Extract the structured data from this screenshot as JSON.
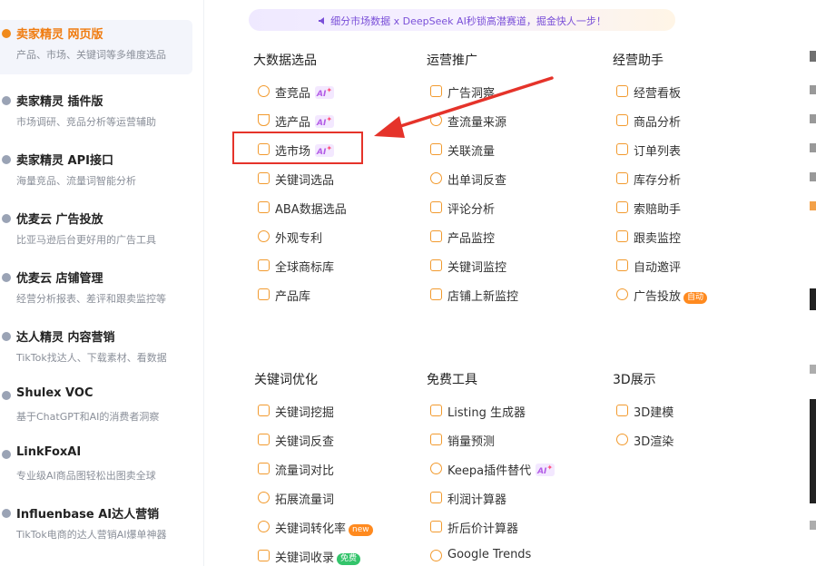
{
  "banner": {
    "text": "细分市场数据 x DeepSeek AI秒锁高潜赛道，掘金快人一步！"
  },
  "sidebar": {
    "items": [
      {
        "title": "卖家精灵 网页版",
        "subtitle": "产品、市场、关键词等多维度选品",
        "active": true
      },
      {
        "title": "卖家精灵 插件版",
        "subtitle": "市场调研、竞品分析等运营辅助",
        "active": false
      },
      {
        "title": "卖家精灵 API接口",
        "subtitle": "海量竞品、流量词智能分析",
        "active": false
      },
      {
        "title": "优麦云 广告投放",
        "subtitle": "比亚马逊后台更好用的广告工具",
        "active": false
      },
      {
        "title": "优麦云 店铺管理",
        "subtitle": "经营分析报表、差评和跟卖监控等",
        "active": false
      },
      {
        "title": "达人精灵 内容营销",
        "subtitle": "TikTok找达人、下载素材、看数据",
        "active": false
      },
      {
        "title": "Shulex VOC",
        "subtitle": "基于ChatGPT和AI的消费者洞察",
        "active": false
      },
      {
        "title": "LinkFoxAI",
        "subtitle": "专业级AI商品图轻松出图卖全球",
        "active": false
      },
      {
        "title": "Influenbase AI达人营销",
        "subtitle": "TikTok电商的达人营销AI爆单神器",
        "active": false
      }
    ]
  },
  "groups": {
    "bigdata": {
      "title": "大数据选品",
      "items": [
        "查竞品",
        "选产品",
        "选市场",
        "关键词选品",
        "ABA数据选品",
        "外观专利",
        "全球商标库",
        "产品库"
      ]
    },
    "ops": {
      "title": "运营推广",
      "items": [
        "广告洞察",
        "查流量来源",
        "关联流量",
        "出单词反查",
        "评论分析",
        "产品监控",
        "关键词监控",
        "店铺上新监控"
      ]
    },
    "assistant": {
      "title": "经营助手",
      "items": [
        "经营看板",
        "商品分析",
        "订单列表",
        "库存分析",
        "索赔助手",
        "跟卖监控",
        "自动邀评",
        "广告投放"
      ]
    },
    "keyword": {
      "title": "关键词优化",
      "items": [
        "关键词挖掘",
        "关键词反查",
        "流量词对比",
        "拓展流量词",
        "关键词转化率",
        "关键词收录"
      ]
    },
    "free": {
      "title": "免费工具",
      "items": [
        "Listing 生成器",
        "销量预测",
        "Keepa插件替代",
        "利润计算器",
        "折后价计算器",
        "Google Trends"
      ]
    },
    "show3d": {
      "title": "3D展示",
      "items": [
        "3D建模",
        "3D渲染"
      ]
    }
  },
  "badges": {
    "ai": "AI",
    "new": "new",
    "free": "免费",
    "auto": "自动"
  },
  "colors": {
    "accent": "#f07c10",
    "highlight": "#e5332a",
    "ai": "#b35ce6"
  }
}
